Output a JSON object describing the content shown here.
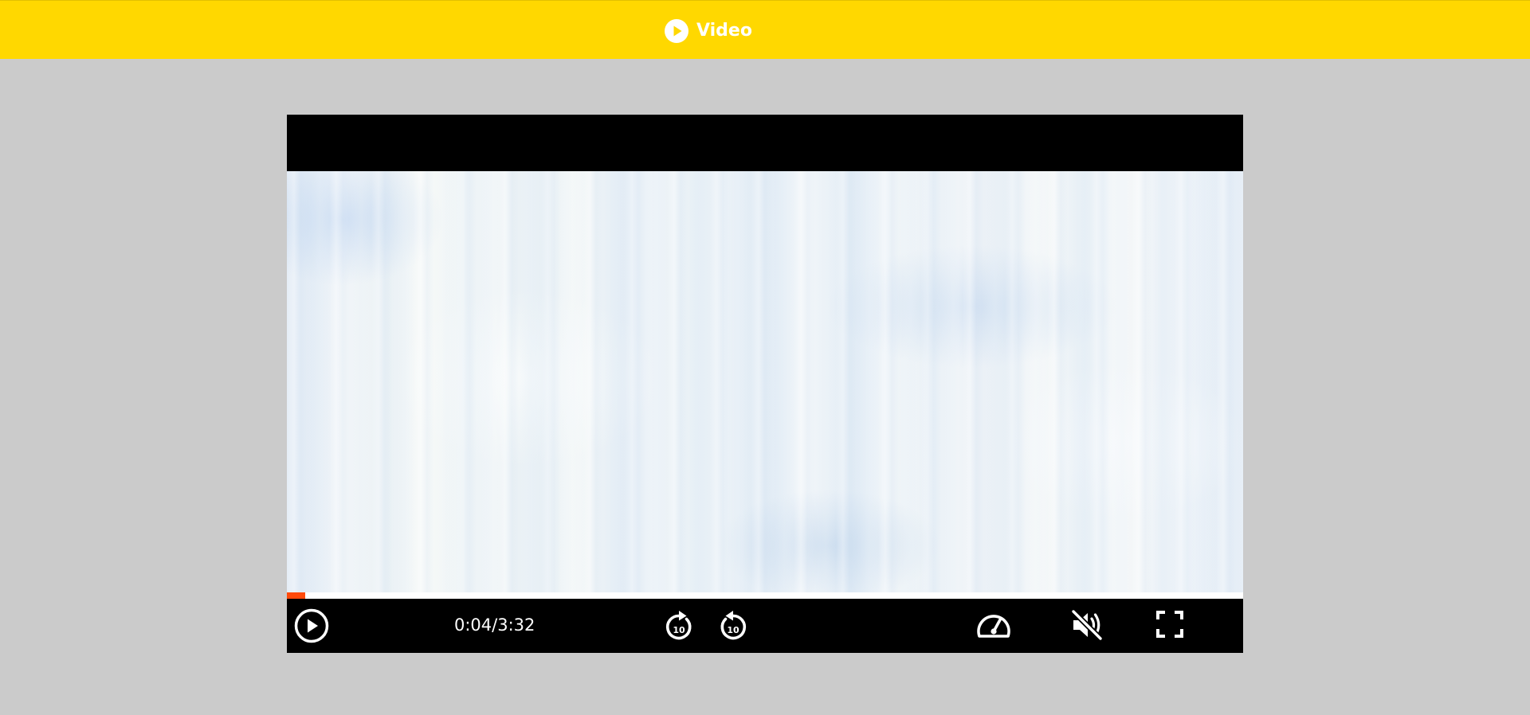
{
  "header": {
    "title": "Video",
    "icon": "play-circle-icon",
    "background_color": "#ffd800"
  },
  "player": {
    "progress_fraction": 0.019,
    "progress_color": "#ff4a0a",
    "time": {
      "current": "0:04",
      "separator": "/",
      "duration": "3:32"
    },
    "controls": {
      "play": {
        "icon": "play-circle-icon"
      },
      "forward_10": {
        "icon": "forward-10-icon",
        "label": "10"
      },
      "rewind_10": {
        "icon": "rewind-10-icon",
        "label": "10"
      },
      "speed": {
        "icon": "speedometer-icon"
      },
      "mute": {
        "icon": "volume-muted-icon"
      },
      "fullscreen": {
        "icon": "fullscreen-icon"
      }
    }
  }
}
